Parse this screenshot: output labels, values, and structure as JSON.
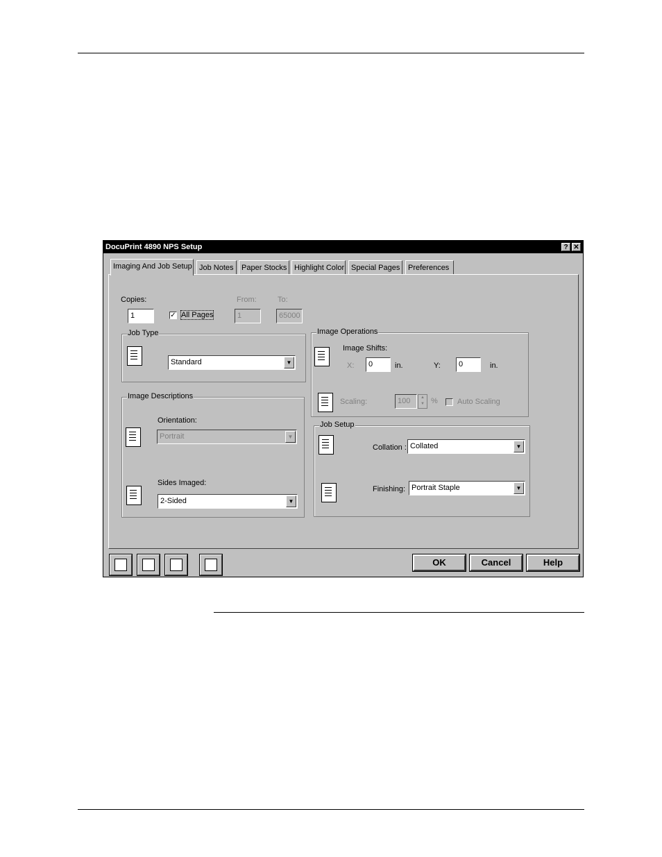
{
  "window": {
    "title": "DocuPrint 4890 NPS Setup",
    "help_button": "?",
    "close_button": "✕"
  },
  "tabs": [
    {
      "label": "Imaging And Job Setup"
    },
    {
      "label": "Job Notes"
    },
    {
      "label": "Paper Stocks"
    },
    {
      "label": "Highlight Color"
    },
    {
      "label": "Special Pages"
    },
    {
      "label": "Preferences"
    }
  ],
  "copies": {
    "label": "Copies:",
    "value": "1",
    "all_pages_label": "All Pages",
    "all_pages_checked": "✓",
    "from_label": "From:",
    "from_value": "1",
    "to_label": "To:",
    "to_value": "65000"
  },
  "job_type": {
    "title": "Job Type",
    "value": "Standard"
  },
  "image_descriptions": {
    "title": "Image Descriptions",
    "orientation_label": "Orientation:",
    "orientation_value": "Portrait",
    "sides_label": "Sides Imaged:",
    "sides_value": "2-Sided"
  },
  "image_operations": {
    "title": "Image Operations",
    "shifts_label": "Image Shifts:",
    "x_label": "X:",
    "x_value": "0",
    "x_unit": "in.",
    "y_label": "Y:",
    "y_value": "0",
    "y_unit": "in.",
    "scaling_label": "Scaling:",
    "scaling_value": "100",
    "scaling_unit": "%",
    "auto_scaling_label": "Auto Scaling"
  },
  "job_setup": {
    "title": "Job Setup",
    "collation_label": "Collation :",
    "collation_value": "Collated",
    "finishing_label": "Finishing:",
    "finishing_value": "Portrait Staple"
  },
  "buttons": {
    "ok": "OK",
    "cancel": "Cancel",
    "help": "Help"
  },
  "toolbar_icons": [
    "printer-setup-icon",
    "save-icon",
    "open-folder-icon",
    "export-icon"
  ]
}
